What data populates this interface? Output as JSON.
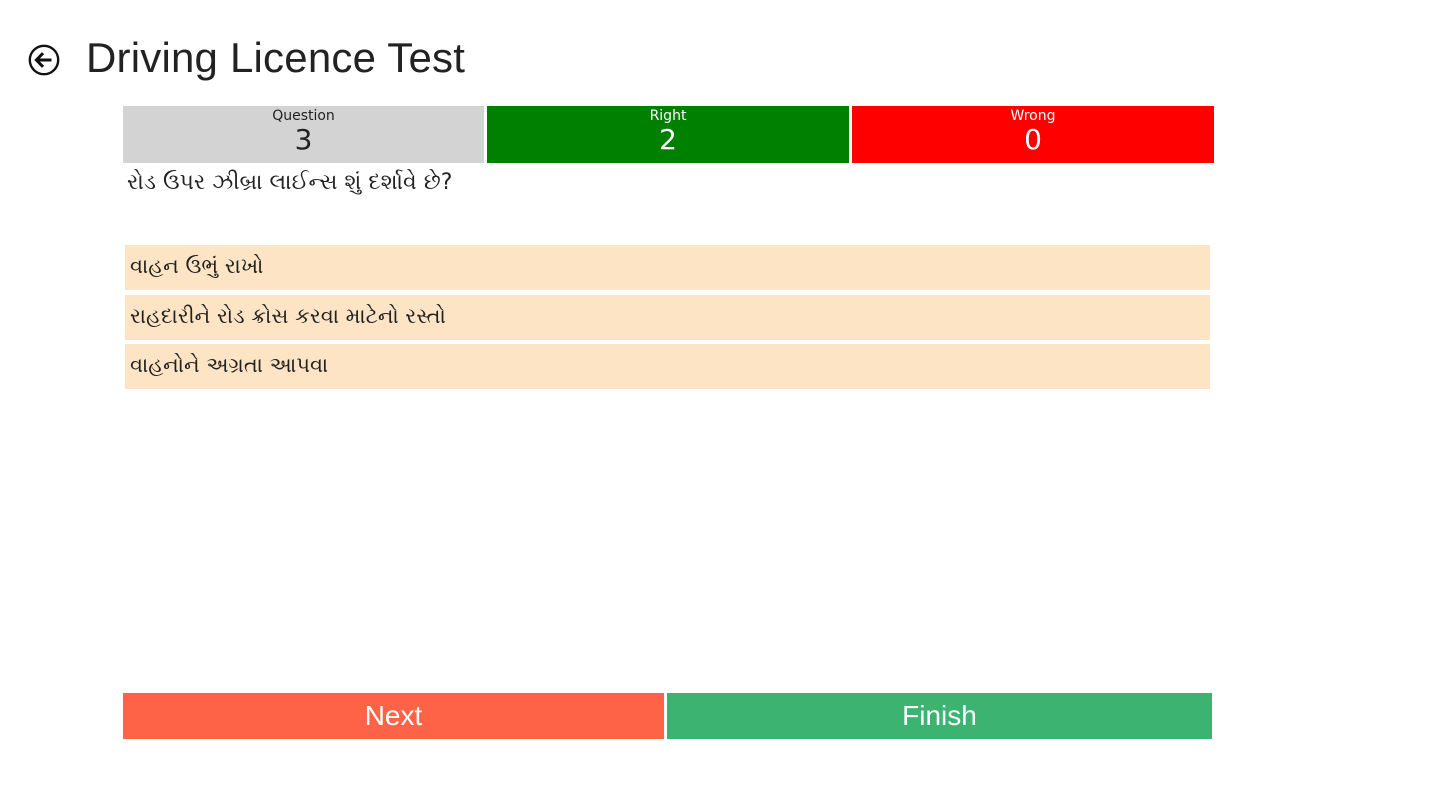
{
  "header": {
    "title": "Driving Licence Test",
    "back_icon": "back-arrow-circle-icon"
  },
  "stats": {
    "question": {
      "label": "Question",
      "value": "3",
      "color": "#d3d3d3"
    },
    "right": {
      "label": "Right",
      "value": "2",
      "color": "#008000"
    },
    "wrong": {
      "label": "Wrong",
      "value": "0",
      "color": "#ff0000"
    }
  },
  "question": {
    "text": "રોડ ઉપર ઝીબ્રા લાઈન્સ શું દર્શાવે છે?"
  },
  "options": [
    {
      "label": "વાહન ઉભું રાખો"
    },
    {
      "label": "રાહદારીને રોડ ક્રોસ કરવા માટેનો રસ્તો"
    },
    {
      "label": "વાહનોને અગ્રતા આપવા"
    }
  ],
  "actions": {
    "next_label": "Next",
    "finish_label": "Finish",
    "next_color": "#ff6347",
    "finish_color": "#3cb371"
  }
}
